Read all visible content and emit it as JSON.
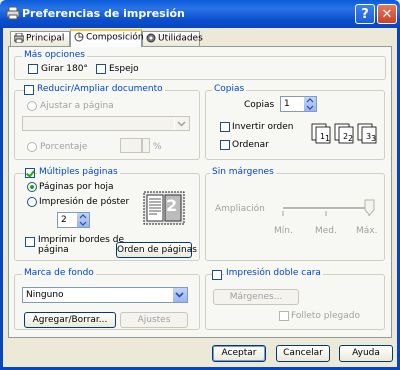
{
  "window": {
    "title": "Preferencias de impresión",
    "help_glyph": "?",
    "close_glyph": "✕"
  },
  "tabs": [
    {
      "label": "Principal",
      "icon": "printer-icon"
    },
    {
      "label": "Composición",
      "icon": "layout-icon"
    },
    {
      "label": "Utilidades",
      "icon": "utility-icon"
    }
  ],
  "mas_opciones": {
    "title": "Más opciones",
    "girar": "Girar 180°",
    "espejo": "Espejo"
  },
  "reducir": {
    "title": "Reducir/Ampliar documento",
    "ajustar": "Ajustar a página",
    "porcentaje": "Porcentaje",
    "percent_sign": "%",
    "dropdown_value": "",
    "percent_value": ""
  },
  "copias": {
    "title": "Copias",
    "label": "Copias",
    "value": "1",
    "invertir": "Invertir orden",
    "ordenar": "Ordenar"
  },
  "multiples": {
    "title": "Múltiples páginas",
    "paginas_por_hoja": "Páginas por hoja",
    "impresion_poster": "Impresión de póster",
    "spin_value": "2",
    "preview_number": "2",
    "imprimir_bordes_1": "Imprimir bordes de",
    "imprimir_bordes_2": "página",
    "orden_button": "Orden de páginas"
  },
  "sin_margenes": {
    "title": "Sin márgenes",
    "ampliacion": "Ampliación",
    "min": "Mín.",
    "med": "Med.",
    "max": "Máx."
  },
  "marca_fondo": {
    "title": "Marca de fondo",
    "value": "Ninguno",
    "agregar": "Agregar/Borrar...",
    "ajustes": "Ajustes"
  },
  "doble_cara": {
    "title": "Impresión doble cara",
    "margenes": "Márgenes...",
    "folleto": "Folleto plegado"
  },
  "footer": {
    "aceptar": "Aceptar",
    "cancelar": "Cancelar",
    "ayuda": "Ayuda"
  }
}
